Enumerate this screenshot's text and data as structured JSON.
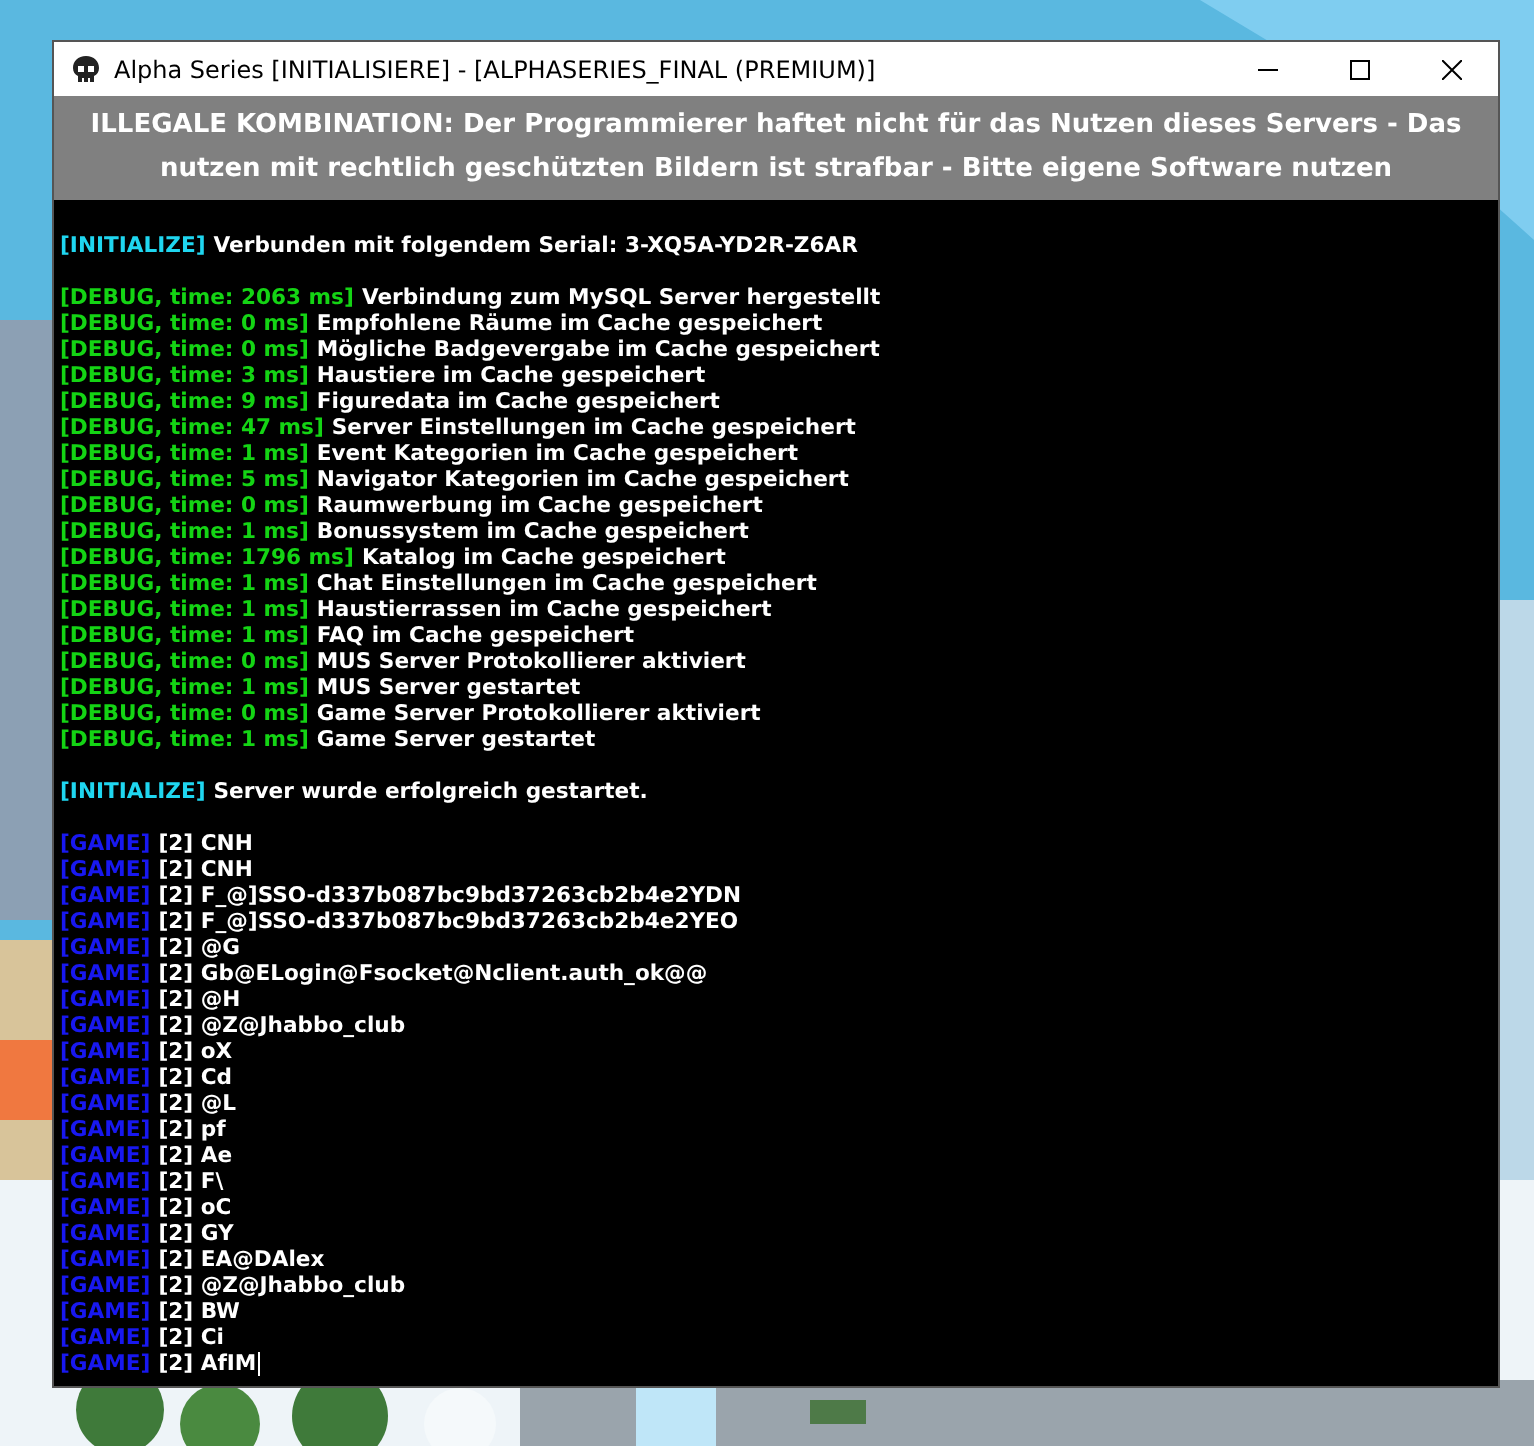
{
  "window": {
    "title": "Alpha Series [INITIALISIERE] - [ALPHASERIES_FINAL (PREMIUM)]"
  },
  "banner": "ILLEGALE KOMBINATION: Der Programmierer haftet nicht für das Nutzen dieses Servers - Das nutzen mit rechtlich geschützten Bildern ist strafbar - Bitte eigene Software nutzen",
  "console": {
    "caret_visible": true,
    "sections": [
      {
        "lines": [
          {
            "kind": "initialize",
            "tag": "[INITIALIZE]",
            "text": "Verbunden mit folgendem Serial: 3-XQ5A-YD2R-Z6AR"
          }
        ]
      },
      {
        "lines": [
          {
            "kind": "debug",
            "tag": "[DEBUG, time: 2063 ms]",
            "text": "Verbindung zum MySQL Server hergestellt"
          },
          {
            "kind": "debug",
            "tag": "[DEBUG, time: 0 ms]",
            "text": "Empfohlene Räume im Cache gespeichert"
          },
          {
            "kind": "debug",
            "tag": "[DEBUG, time: 0 ms]",
            "text": "Mögliche Badgevergabe im Cache gespeichert"
          },
          {
            "kind": "debug",
            "tag": "[DEBUG, time: 3 ms]",
            "text": "Haustiere im Cache gespeichert"
          },
          {
            "kind": "debug",
            "tag": "[DEBUG, time: 9 ms]",
            "text": "Figuredata im Cache gespeichert"
          },
          {
            "kind": "debug",
            "tag": "[DEBUG, time: 47 ms]",
            "text": "Server Einstellungen im Cache gespeichert"
          },
          {
            "kind": "debug",
            "tag": "[DEBUG, time: 1 ms]",
            "text": "Event Kategorien im Cache gespeichert"
          },
          {
            "kind": "debug",
            "tag": "[DEBUG, time: 5 ms]",
            "text": "Navigator Kategorien im Cache gespeichert"
          },
          {
            "kind": "debug",
            "tag": "[DEBUG, time: 0 ms]",
            "text": "Raumwerbung im Cache gespeichert"
          },
          {
            "kind": "debug",
            "tag": "[DEBUG, time: 1 ms]",
            "text": "Bonussystem im Cache gespeichert"
          },
          {
            "kind": "debug",
            "tag": "[DEBUG, time: 1796 ms]",
            "text": "Katalog im Cache gespeichert"
          },
          {
            "kind": "debug",
            "tag": "[DEBUG, time: 1 ms]",
            "text": "Chat Einstellungen im Cache gespeichert"
          },
          {
            "kind": "debug",
            "tag": "[DEBUG, time: 1 ms]",
            "text": "Haustierrassen im Cache gespeichert"
          },
          {
            "kind": "debug",
            "tag": "[DEBUG, time: 1 ms]",
            "text": "FAQ im Cache gespeichert"
          },
          {
            "kind": "debug",
            "tag": "[DEBUG, time: 0 ms]",
            "text": "MUS Server Protokollierer aktiviert"
          },
          {
            "kind": "debug",
            "tag": "[DEBUG, time: 1 ms]",
            "text": "MUS Server gestartet"
          },
          {
            "kind": "debug",
            "tag": "[DEBUG, time: 0 ms]",
            "text": "Game Server Protokollierer aktiviert"
          },
          {
            "kind": "debug",
            "tag": "[DEBUG, time: 1 ms]",
            "text": "Game Server gestartet"
          }
        ]
      },
      {
        "lines": [
          {
            "kind": "initialize",
            "tag": "[INITIALIZE]",
            "text": "Server wurde erfolgreich gestartet."
          }
        ]
      },
      {
        "lines": [
          {
            "kind": "game",
            "tag": "[GAME]",
            "text": "[2] CNH"
          },
          {
            "kind": "game",
            "tag": "[GAME]",
            "text": "[2] CNH"
          },
          {
            "kind": "game",
            "tag": "[GAME]",
            "text": "[2] F_@]SSO-d337b087bc9bd37263cb2b4e2YDN"
          },
          {
            "kind": "game",
            "tag": "[GAME]",
            "text": "[2] F_@]SSO-d337b087bc9bd37263cb2b4e2YEO"
          },
          {
            "kind": "game",
            "tag": "[GAME]",
            "text": "[2] @G"
          },
          {
            "kind": "game",
            "tag": "[GAME]",
            "text": "[2] Gb@ELogin@Fsocket@Nclient.auth_ok@@"
          },
          {
            "kind": "game",
            "tag": "[GAME]",
            "text": "[2] @H"
          },
          {
            "kind": "game",
            "tag": "[GAME]",
            "text": "[2] @Z@Jhabbo_club"
          },
          {
            "kind": "game",
            "tag": "[GAME]",
            "text": "[2] oX"
          },
          {
            "kind": "game",
            "tag": "[GAME]",
            "text": "[2] Cd"
          },
          {
            "kind": "game",
            "tag": "[GAME]",
            "text": "[2] @L"
          },
          {
            "kind": "game",
            "tag": "[GAME]",
            "text": "[2] pf"
          },
          {
            "kind": "game",
            "tag": "[GAME]",
            "text": "[2] Ae"
          },
          {
            "kind": "game",
            "tag": "[GAME]",
            "text": "[2] F\\"
          },
          {
            "kind": "game",
            "tag": "[GAME]",
            "text": "[2] oC"
          },
          {
            "kind": "game",
            "tag": "[GAME]",
            "text": "[2] GY"
          },
          {
            "kind": "game",
            "tag": "[GAME]",
            "text": "[2] EA@DAlex"
          },
          {
            "kind": "game",
            "tag": "[GAME]",
            "text": "[2] @Z@Jhabbo_club"
          },
          {
            "kind": "game",
            "tag": "[GAME]",
            "text": "[2] BW"
          },
          {
            "kind": "game",
            "tag": "[GAME]",
            "text": "[2] Ci"
          },
          {
            "kind": "game",
            "tag": "[GAME]",
            "text": "[2] AfIM"
          }
        ]
      }
    ]
  }
}
